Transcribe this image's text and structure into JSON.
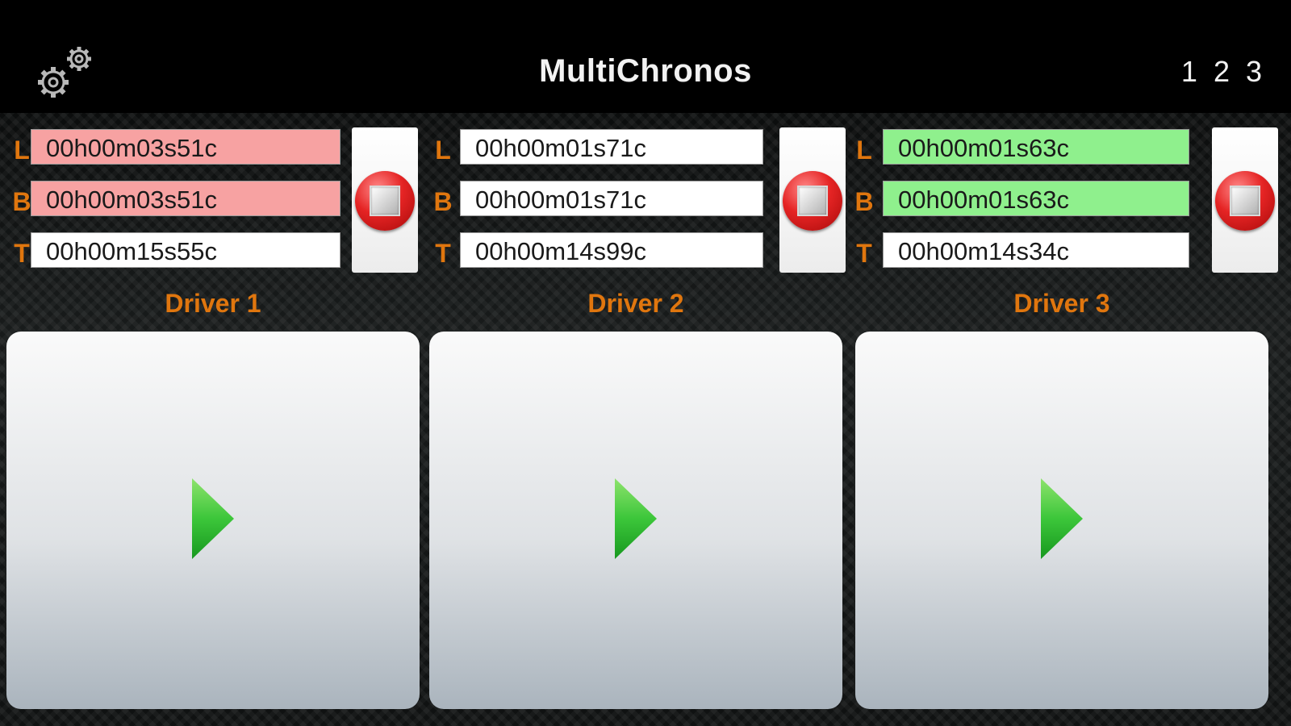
{
  "header": {
    "title": "MultiChronos",
    "settings_icon": "gear-icon",
    "pages": [
      "1",
      "2",
      "3"
    ]
  },
  "colors": {
    "accent": "#e0760e",
    "slower_highlight": "#f7a2a2",
    "faster_highlight": "#8ff08d",
    "stop_button": "#e52424",
    "play_icon": "#3cc63a"
  },
  "drivers": [
    {
      "name": "Driver 1",
      "rows": [
        {
          "label": "L",
          "value": "00h00m03s51c",
          "highlight": "red"
        },
        {
          "label": "B",
          "value": "00h00m03s51c",
          "highlight": "red"
        },
        {
          "label": "T",
          "value": "00h00m15s55c",
          "highlight": "none"
        }
      ],
      "stop_icon": "stop-icon",
      "start_icon": "play-icon"
    },
    {
      "name": "Driver 2",
      "rows": [
        {
          "label": "L",
          "value": "00h00m01s71c",
          "highlight": "none"
        },
        {
          "label": "B",
          "value": "00h00m01s71c",
          "highlight": "none"
        },
        {
          "label": "T",
          "value": "00h00m14s99c",
          "highlight": "none"
        }
      ],
      "stop_icon": "stop-icon",
      "start_icon": "play-icon"
    },
    {
      "name": "Driver 3",
      "rows": [
        {
          "label": "L",
          "value": "00h00m01s63c",
          "highlight": "green"
        },
        {
          "label": "B",
          "value": "00h00m01s63c",
          "highlight": "green"
        },
        {
          "label": "T",
          "value": "00h00m14s34c",
          "highlight": "none"
        }
      ],
      "stop_icon": "stop-icon",
      "start_icon": "play-icon"
    }
  ]
}
